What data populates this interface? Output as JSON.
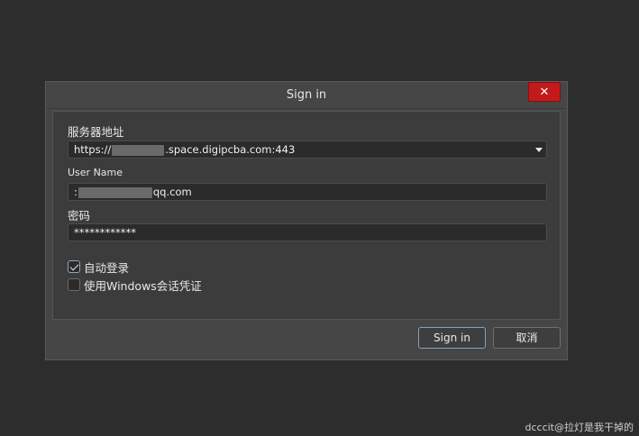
{
  "dialog": {
    "title": "Sign in",
    "close_label": "✕"
  },
  "server": {
    "label": "服务器地址",
    "value_prefix": "https://",
    "value_suffix": ".space.digipcba.com:443"
  },
  "username": {
    "label": "User Name",
    "value_prefix": ":",
    "value_suffix": "qq.com"
  },
  "password": {
    "label": "密码",
    "value": "************"
  },
  "options": {
    "auto_login_label": "自动登录",
    "auto_login_checked": true,
    "windows_cred_label": "使用Windows会话凭证",
    "windows_cred_checked": false
  },
  "buttons": {
    "signin_label": "Sign in",
    "cancel_label": "取消"
  },
  "watermark": "dcccit@拉灯是我干掉的",
  "colors": {
    "close_bg": "#c21a1a",
    "primary_border": "#7fa3c6"
  }
}
